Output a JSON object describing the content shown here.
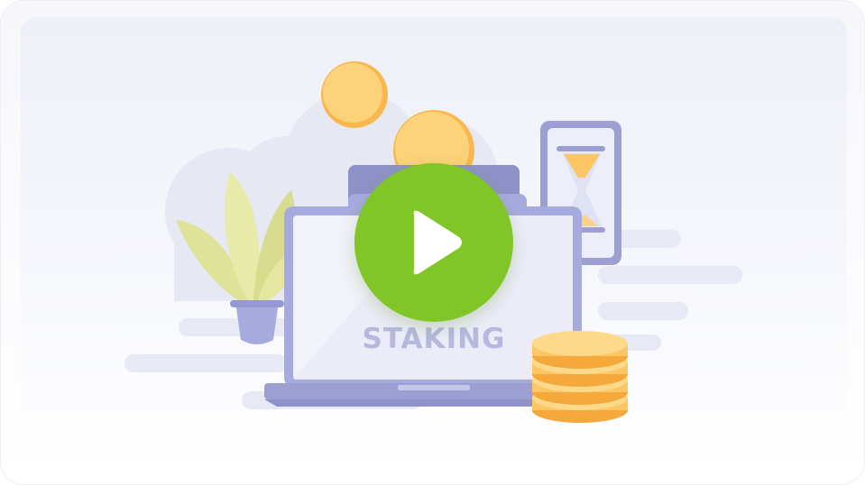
{
  "illustration": {
    "caption": "STAKING",
    "play_button_icon": "play-icon",
    "colors": {
      "accent_green": "#80c626",
      "laptop_frame": "#9d9fd3",
      "coin_gold": "#fcc665",
      "plant_leaf": "#dfe39a",
      "cloud": "#e6e8f4"
    }
  }
}
